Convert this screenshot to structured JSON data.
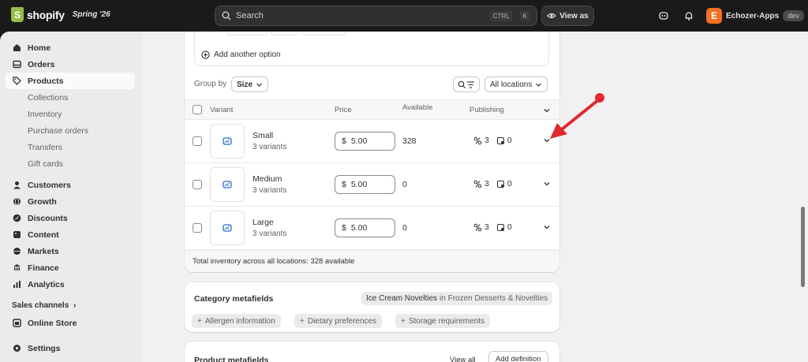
{
  "topbar": {
    "brand": "shopify",
    "season": "Spring '26",
    "search_placeholder": "Search",
    "shortcut_keys": [
      "CTRL",
      "K"
    ],
    "view_as_label": "View as",
    "store_initial": "E",
    "store_name": "Echozer-Apps",
    "store_badge": "dev"
  },
  "sidebar": {
    "items": [
      {
        "label": "Home",
        "icon": "home-icon"
      },
      {
        "label": "Orders",
        "icon": "inbox-icon"
      },
      {
        "label": "Products",
        "icon": "tag-icon",
        "active": true
      }
    ],
    "product_subitems": [
      "Collections",
      "Inventory",
      "Purchase orders",
      "Transfers",
      "Gift cards"
    ],
    "items2": [
      {
        "label": "Customers",
        "icon": "person-icon"
      },
      {
        "label": "Growth",
        "icon": "globe-icon"
      },
      {
        "label": "Discounts",
        "icon": "discount-icon"
      },
      {
        "label": "Content",
        "icon": "image-icon"
      },
      {
        "label": "Markets",
        "icon": "globe-icon"
      },
      {
        "label": "Finance",
        "icon": "bank-icon"
      },
      {
        "label": "Analytics",
        "icon": "chart-icon"
      }
    ],
    "sales_channels_label": "Sales channels",
    "online_store_label": "Online Store",
    "settings_label": "Settings"
  },
  "variants": {
    "add_option_label": "Add another option",
    "group_by_label": "Group by",
    "group_by_value": "Size",
    "locations_value": "All locations",
    "headers": {
      "variant": "Variant",
      "price": "Price",
      "available": "Available",
      "publishing": "Publishing"
    },
    "currency": "$",
    "rows": [
      {
        "name": "Small",
        "count": "3 variants",
        "price": "5.00",
        "available": "328",
        "channels": "3",
        "catalogs": "0"
      },
      {
        "name": "Medium",
        "count": "3 variants",
        "price": "5.00",
        "available": "0",
        "channels": "3",
        "catalogs": "0"
      },
      {
        "name": "Large",
        "count": "3 variants",
        "price": "5.00",
        "available": "0",
        "channels": "3",
        "catalogs": "0"
      }
    ],
    "total_text": "Total inventory across all locations: 328 available"
  },
  "category_metafields": {
    "title": "Category metafields",
    "category": "Ice Cream Novelties",
    "category_path": "in Frozen Desserts & Novelties",
    "tags": [
      "Allergen information",
      "Dietary preferences",
      "Storage requirements"
    ]
  },
  "product_metafields": {
    "title": "Product metafields",
    "view_all_label": "View all",
    "add_definition_label": "Add definition"
  },
  "colors": {
    "annotation_arrow": "#e0282e",
    "brand_green": "#95bf47",
    "store_logo": "#f37021"
  }
}
